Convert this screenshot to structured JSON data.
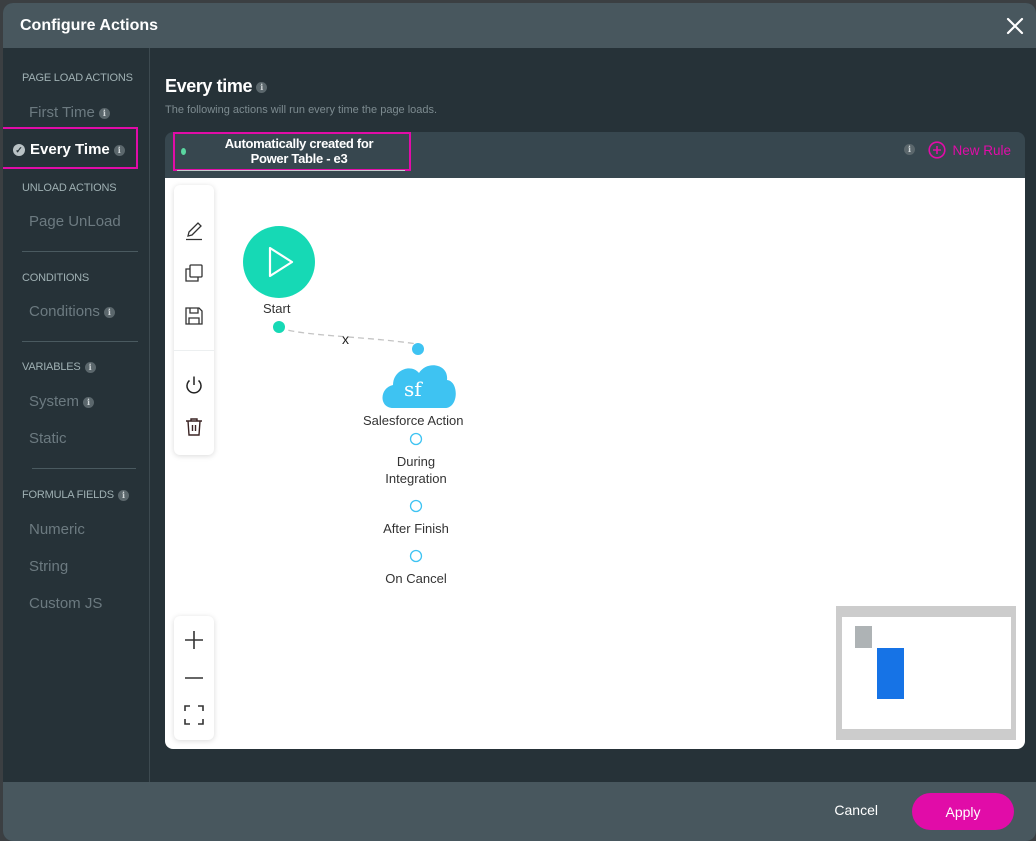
{
  "modal": {
    "title": "Configure Actions",
    "close_icon": "close-icon"
  },
  "sidebar": {
    "sections": [
      {
        "title": "PAGE LOAD ACTIONS",
        "has_info": false
      },
      {
        "title": "UNLOAD ACTIONS",
        "has_info": false
      },
      {
        "title": "CONDITIONS",
        "has_info": false
      },
      {
        "title": "VARIABLES",
        "has_info": true
      },
      {
        "title": "FORMULA FIELDS",
        "has_info": true
      }
    ],
    "items": [
      {
        "label": "First Time",
        "section": "PAGE LOAD ACTIONS",
        "has_info": true,
        "active": false
      },
      {
        "label": "Every Time",
        "section": "PAGE LOAD ACTIONS",
        "has_info": true,
        "active": true
      },
      {
        "label": "Page UnLoad",
        "section": "UNLOAD ACTIONS",
        "has_info": false,
        "active": false
      },
      {
        "label": "Conditions",
        "section": "CONDITIONS",
        "has_info": true,
        "active": false
      },
      {
        "label": "System",
        "section": "VARIABLES",
        "has_info": true,
        "active": false
      },
      {
        "label": "Static",
        "section": "VARIABLES",
        "has_info": false,
        "active": false
      },
      {
        "label": "Numeric",
        "section": "FORMULA FIELDS",
        "has_info": false,
        "active": false
      },
      {
        "label": "String",
        "section": "FORMULA FIELDS",
        "has_info": false,
        "active": false
      },
      {
        "label": "Custom JS",
        "section": "FORMULA FIELDS",
        "has_info": false,
        "active": false
      }
    ],
    "info_glyph": "i",
    "check_glyph": "✓"
  },
  "main": {
    "title": "Every time",
    "subtitle": "The following actions will run every time the page loads.",
    "rule_tab": {
      "line1": "Automatically created for",
      "line2": "Power Table - e3",
      "status_color": "#5ad6a0"
    },
    "new_rule_label": "New Rule"
  },
  "toolbar": {
    "tools": [
      {
        "name": "edit",
        "icon": "pencil-icon"
      },
      {
        "name": "duplicate",
        "icon": "copy-icon"
      },
      {
        "name": "save",
        "icon": "save-icon"
      },
      {
        "name": "toggle",
        "icon": "power-icon"
      },
      {
        "name": "delete",
        "icon": "trash-icon"
      }
    ],
    "zoom": [
      {
        "name": "zoom-in",
        "icon": "plus-icon"
      },
      {
        "name": "zoom-out",
        "icon": "minus-icon"
      },
      {
        "name": "fit",
        "icon": "fit-screen-icon"
      }
    ]
  },
  "flow": {
    "start": {
      "label": "Start",
      "color": "#16d9b5"
    },
    "connector_label": "x",
    "action": {
      "label": "Salesforce Action",
      "icon_text": "sf",
      "color": "#3ec3f2"
    },
    "outputs": [
      {
        "label_line1": "During",
        "label_line2": "Integration"
      },
      {
        "label_line1": "After Finish",
        "label_line2": ""
      },
      {
        "label_line1": "On Cancel",
        "label_line2": ""
      }
    ]
  },
  "footer": {
    "cancel_label": "Cancel",
    "apply_label": "Apply"
  },
  "colors": {
    "accent": "#e10ca8",
    "header_bg": "#48575e",
    "body_bg": "#263238",
    "minimap_node": "#1673e6"
  }
}
